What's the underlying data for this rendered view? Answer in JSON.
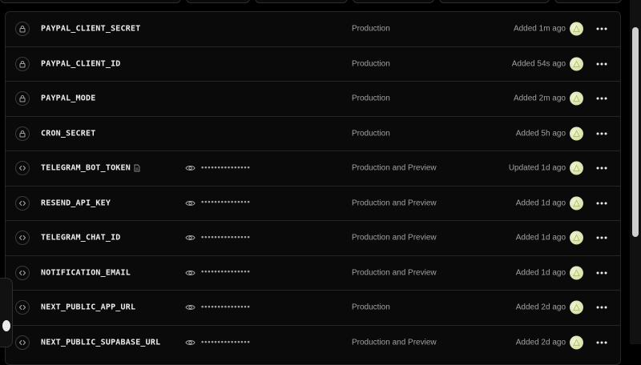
{
  "env_vars": [
    {
      "key": "PAYPAL_CLIENT_SECRET",
      "type": "sensitive",
      "type_icon": "lock-icon",
      "secret": "",
      "env": "Production",
      "time": "Added 1m ago"
    },
    {
      "key": "PAYPAL_CLIENT_ID",
      "type": "sensitive",
      "type_icon": "lock-icon",
      "secret": "",
      "env": "Production",
      "time": "Added 54s ago"
    },
    {
      "key": "PAYPAL_MODE",
      "type": "sensitive",
      "type_icon": "lock-icon",
      "secret": "",
      "env": "Production",
      "time": "Added 2m ago"
    },
    {
      "key": "CRON_SECRET",
      "type": "sensitive",
      "type_icon": "lock-icon",
      "secret": "",
      "env": "Production",
      "time": "Added 5h ago"
    },
    {
      "key": "TELEGRAM_BOT_TOKEN",
      "type": "plain",
      "type_icon": "code-icon",
      "has_note": true,
      "secret": "•••••••••••••••",
      "env": "Production and Preview",
      "time": "Updated 1d ago"
    },
    {
      "key": "RESEND_API_KEY",
      "type": "plain",
      "type_icon": "code-icon",
      "secret": "•••••••••••••••",
      "env": "Production and Preview",
      "time": "Added 1d ago"
    },
    {
      "key": "TELEGRAM_CHAT_ID",
      "type": "plain",
      "type_icon": "code-icon",
      "secret": "•••••••••••••••",
      "env": "Production and Preview",
      "time": "Added 1d ago"
    },
    {
      "key": "NOTIFICATION_EMAIL",
      "type": "plain",
      "type_icon": "code-icon",
      "secret": "•••••••••••••••",
      "env": "Production and Preview",
      "time": "Added 1d ago"
    },
    {
      "key": "NEXT_PUBLIC_APP_URL",
      "type": "plain",
      "type_icon": "code-icon",
      "secret": "•••••••••••••••",
      "env": "Production",
      "time": "Added 2d ago"
    },
    {
      "key": "NEXT_PUBLIC_SUPABASE_URL",
      "type": "plain",
      "type_icon": "code-icon",
      "secret": "•••••••••••••••",
      "env": "Production and Preview",
      "time": "Added 2d ago"
    }
  ],
  "colors": {
    "background": "#0a0a0a",
    "border": "#262626",
    "text": "#ededed",
    "muted": "#a1a1a1",
    "avatar": "#dce8b0"
  }
}
